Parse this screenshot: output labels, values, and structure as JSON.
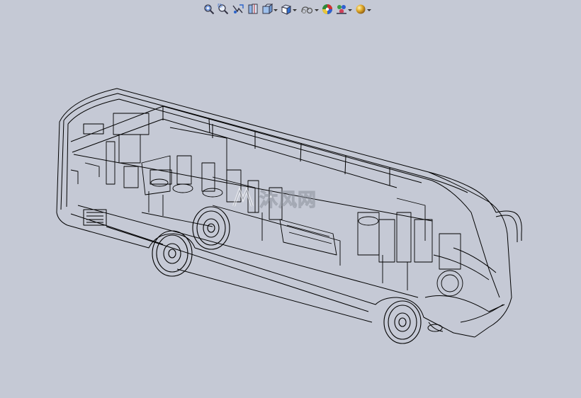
{
  "app": {
    "viewport_background": "#c5c9d5",
    "wireframe_color": "#000000"
  },
  "toolbar": {
    "buttons": [
      {
        "id": "zoom-to-fit",
        "icon": "zoom-to-fit-icon"
      },
      {
        "id": "zoom-to-area",
        "icon": "zoom-to-area-icon"
      },
      {
        "id": "previous-view",
        "icon": "previous-view-icon"
      },
      {
        "id": "section-view",
        "icon": "section-view-icon"
      },
      {
        "id": "dynamic-annotation",
        "icon": "dynamic-annotation-icon",
        "dropdown": true
      },
      {
        "id": "view-orientation",
        "icon": "view-orientation-icon",
        "dropdown": true
      },
      {
        "id": "display-style",
        "icon": "display-style-icon",
        "dropdown": true
      },
      {
        "id": "hide-show-items",
        "icon": "hide-show-items-icon",
        "dropdown": true
      },
      {
        "id": "edit-appearance",
        "icon": "edit-appearance-icon"
      },
      {
        "id": "apply-scene",
        "icon": "apply-scene-icon",
        "dropdown": true
      },
      {
        "id": "view-settings",
        "icon": "view-settings-icon",
        "dropdown": true
      }
    ]
  },
  "model": {
    "name": "bus-wireframe-model",
    "display_style": "wireframe"
  },
  "watermark": {
    "text": "沐风网",
    "icon": "watermark-logo-icon"
  }
}
